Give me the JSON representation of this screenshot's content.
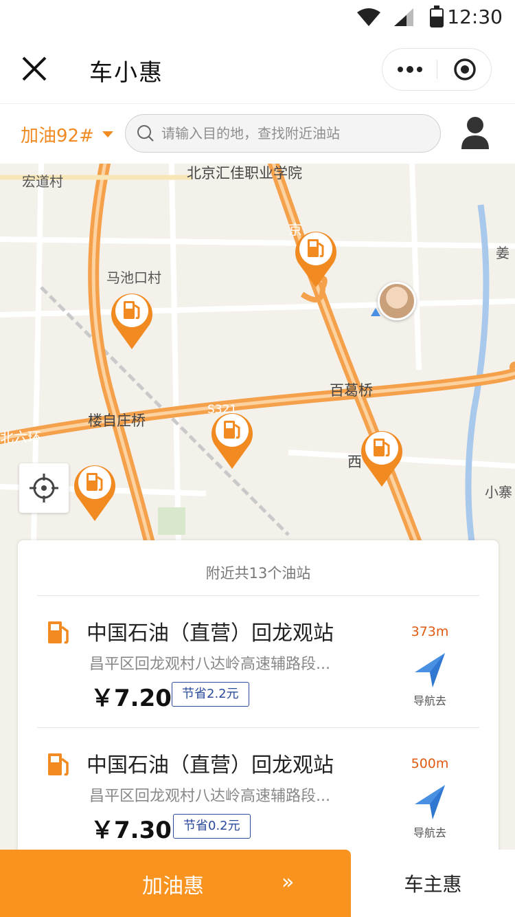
{
  "status_bar": {
    "time": "12:30"
  },
  "navbar": {
    "title": "车小惠"
  },
  "filter": {
    "fuel_type": "加油92#"
  },
  "search": {
    "placeholder": "请输入目的地，查找附近油站"
  },
  "map": {
    "labels": [
      "宏道村",
      "北京汇佳职业学院",
      "马池口村",
      "楼自庄桥",
      "百葛桥",
      "北六环",
      "S321",
      "西",
      "姜",
      "小寨",
      "京"
    ]
  },
  "list": {
    "count_text": "附近共13个油站",
    "stations": [
      {
        "name": "中国石油（直营）回龙观站",
        "address": "昌平区回龙观村八达岭高速辅路段...",
        "price": "￥7.20",
        "saving": "节省2.2元",
        "distance": "373m",
        "nav_label": "导航去"
      },
      {
        "name": "中国石油（直营）回龙观站",
        "address": "昌平区回龙观村八达岭高速辅路段...",
        "price": "￥7.30",
        "saving": "节省0.2元",
        "distance": "500m",
        "nav_label": "导航去"
      }
    ]
  },
  "tabs": {
    "active": "加油惠",
    "active_arrow": "»",
    "other": "车主惠"
  },
  "colors": {
    "accent": "#f7931e",
    "road": "#f5a04a",
    "distance": "#e05a10",
    "saving_border": "#2a4a9a",
    "nav_arrow": "#4a90e2"
  }
}
